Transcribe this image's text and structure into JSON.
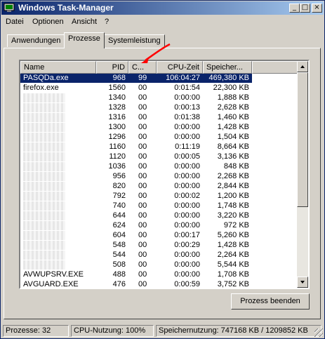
{
  "window": {
    "title": "Windows Task-Manager"
  },
  "menu": [
    "Datei",
    "Optionen",
    "Ansicht",
    "?"
  ],
  "tabs": [
    "Anwendungen",
    "Prozesse",
    "Systemleistung"
  ],
  "columns": {
    "name": "Name",
    "pid": "PID",
    "cpu": "C...",
    "cputime": "CPU-Zeit",
    "mem": "Speicher..."
  },
  "rows": [
    {
      "name": "PASQDa.exe",
      "pid": "968",
      "cpu": "99",
      "time": "106:04:27",
      "mem": "469,380 KB",
      "selected": true
    },
    {
      "name": "firefox.exe",
      "pid": "1560",
      "cpu": "00",
      "time": "0:01:54",
      "mem": "22,300 KB"
    },
    {
      "name": "",
      "pid": "1340",
      "cpu": "00",
      "time": "0:00:00",
      "mem": "1,888 KB"
    },
    {
      "name": "",
      "pid": "1328",
      "cpu": "00",
      "time": "0:00:13",
      "mem": "2,628 KB"
    },
    {
      "name": "",
      "pid": "1316",
      "cpu": "00",
      "time": "0:01:38",
      "mem": "1,460 KB"
    },
    {
      "name": "",
      "pid": "1300",
      "cpu": "00",
      "time": "0:00:00",
      "mem": "1,428 KB"
    },
    {
      "name": "",
      "pid": "1296",
      "cpu": "00",
      "time": "0:00:00",
      "mem": "1,504 KB"
    },
    {
      "name": "",
      "pid": "1160",
      "cpu": "00",
      "time": "0:11:19",
      "mem": "8,664 KB"
    },
    {
      "name": "",
      "pid": "1120",
      "cpu": "00",
      "time": "0:00:05",
      "mem": "3,136 KB"
    },
    {
      "name": "",
      "pid": "1036",
      "cpu": "00",
      "time": "0:00:00",
      "mem": "848 KB"
    },
    {
      "name": "",
      "pid": "956",
      "cpu": "00",
      "time": "0:00:00",
      "mem": "2,268 KB"
    },
    {
      "name": "",
      "pid": "820",
      "cpu": "00",
      "time": "0:00:00",
      "mem": "2,844 KB"
    },
    {
      "name": "",
      "pid": "792",
      "cpu": "00",
      "time": "0:00:02",
      "mem": "1,200 KB"
    },
    {
      "name": "",
      "pid": "740",
      "cpu": "00",
      "time": "0:00:00",
      "mem": "1,748 KB"
    },
    {
      "name": "",
      "pid": "644",
      "cpu": "00",
      "time": "0:00:00",
      "mem": "3,220 KB"
    },
    {
      "name": "",
      "pid": "624",
      "cpu": "00",
      "time": "0:00:00",
      "mem": "972 KB"
    },
    {
      "name": "",
      "pid": "604",
      "cpu": "00",
      "time": "0:00:17",
      "mem": "5,260 KB"
    },
    {
      "name": "",
      "pid": "548",
      "cpu": "00",
      "time": "0:00:29",
      "mem": "1,428 KB"
    },
    {
      "name": "",
      "pid": "544",
      "cpu": "00",
      "time": "0:00:00",
      "mem": "2,264 KB"
    },
    {
      "name": "",
      "pid": "508",
      "cpu": "00",
      "time": "0:00:00",
      "mem": "5,544 KB"
    },
    {
      "name": "AVWUPSRV.EXE",
      "pid": "488",
      "cpu": "00",
      "time": "0:00:00",
      "mem": "1,708 KB"
    },
    {
      "name": "AVGUARD.EXE",
      "pid": "476",
      "cpu": "00",
      "time": "0:00:59",
      "mem": "3,752 KB"
    }
  ],
  "buttons": {
    "end_process": "Prozess beenden"
  },
  "status": {
    "processes": "Prozesse: 32",
    "cpu": "CPU-Nutzung: 100%",
    "memory": "Speichernutzung: 747168 KB / 1209852 KB"
  },
  "colors": {
    "titlebar": "#0a246a",
    "selection": "#0a246a",
    "annotation": "#ff0000"
  }
}
